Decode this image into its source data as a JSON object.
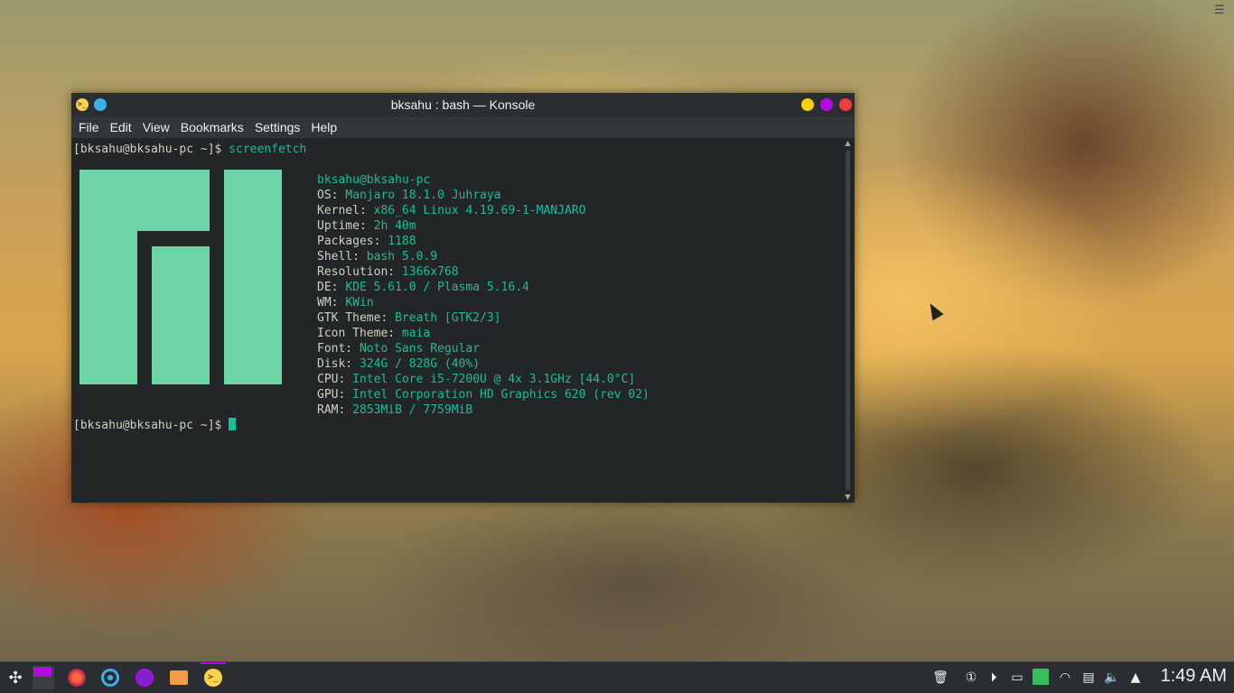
{
  "window": {
    "title": "bksahu : bash — Konsole",
    "menu": [
      "File",
      "Edit",
      "View",
      "Bookmarks",
      "Settings",
      "Help"
    ]
  },
  "terminal": {
    "prompt": "[bksahu@bksahu-pc ~]$ ",
    "command": "screenfetch",
    "info_header": "bksahu@bksahu-pc",
    "info": [
      {
        "key": "OS: ",
        "value": "Manjaro 18.1.0 Juhraya"
      },
      {
        "key": "Kernel: ",
        "value": "x86_64 Linux 4.19.69-1-MANJARO"
      },
      {
        "key": "Uptime: ",
        "value": "2h 40m"
      },
      {
        "key": "Packages: ",
        "value": "1188"
      },
      {
        "key": "Shell: ",
        "value": "bash 5.0.9"
      },
      {
        "key": "Resolution: ",
        "value": "1366x768"
      },
      {
        "key": "DE: ",
        "value": "KDE 5.61.0 / Plasma 5.16.4"
      },
      {
        "key": "WM: ",
        "value": "KWin"
      },
      {
        "key": "GTK Theme: ",
        "value": "Breath [GTK2/3]"
      },
      {
        "key": "Icon Theme: ",
        "value": "maia"
      },
      {
        "key": "Font: ",
        "value": "Noto Sans Regular"
      },
      {
        "key": "Disk: ",
        "value": "324G / 828G (40%)"
      },
      {
        "key": "CPU: ",
        "value": "Intel Core i5-7200U @ 4x 3.1GHz [44.0°C]"
      },
      {
        "key": "GPU: ",
        "value": "Intel Corporation HD Graphics 620 (rev 02)"
      },
      {
        "key": "RAM: ",
        "value": "2853MiB / 7759MiB"
      }
    ],
    "prompt_color": "#1abc9c",
    "logo_color": "#6ed4a7"
  },
  "taskbar": {
    "clock": "1:49 AM",
    "accent": "#b409e3",
    "apps": [
      "application-launcher-icon",
      "pager-icon",
      "firefox-icon",
      "chromium-icon",
      "mail-icon",
      "file-manager-icon",
      "konsole-icon"
    ],
    "tray": [
      "clipboard-icon",
      "notifications-icon",
      "media-icon",
      "battery-icon",
      "manjaro-icon",
      "wifi-icon",
      "storage-icon",
      "volume-icon",
      "expand-tray-icon"
    ]
  }
}
